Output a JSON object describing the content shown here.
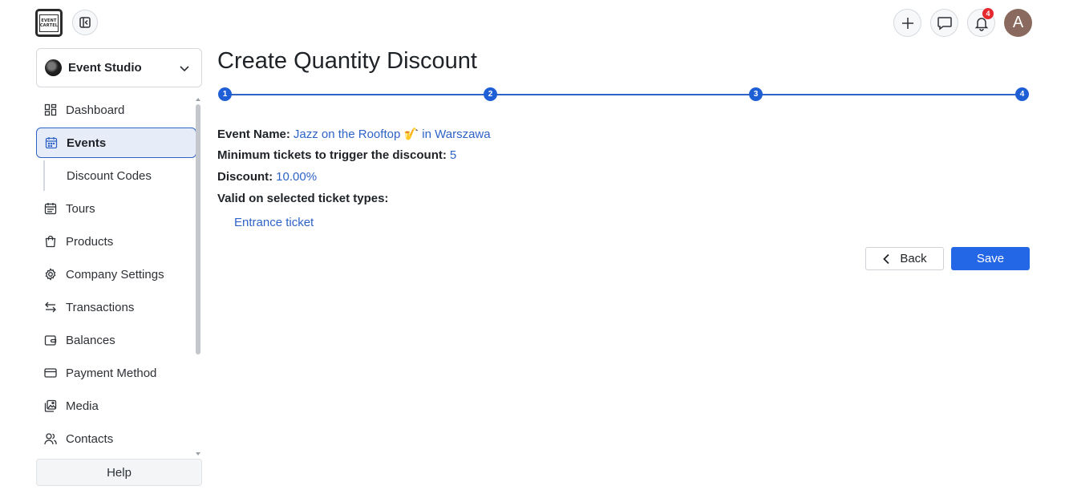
{
  "brand": {
    "logo_line1": "EVENT",
    "logo_line2": "CARTEL"
  },
  "header": {
    "notification_count": "4",
    "avatar_initial": "A"
  },
  "org_selector": {
    "name": "Event Studio"
  },
  "sidebar": {
    "items": [
      {
        "label": "Dashboard",
        "icon": "dashboard-icon"
      },
      {
        "label": "Events",
        "icon": "calendar-icon",
        "active": true
      },
      {
        "label": "Discount Codes",
        "sub": true
      },
      {
        "label": "Tours",
        "icon": "calendar-list-icon"
      },
      {
        "label": "Products",
        "icon": "shopping-bag-icon"
      },
      {
        "label": "Company Settings",
        "icon": "gear-icon"
      },
      {
        "label": "Transactions",
        "icon": "transfer-arrows-icon"
      },
      {
        "label": "Balances",
        "icon": "wallet-icon"
      },
      {
        "label": "Payment Method",
        "icon": "credit-card-icon"
      },
      {
        "label": "Media",
        "icon": "images-icon"
      },
      {
        "label": "Contacts",
        "icon": "users-icon"
      }
    ],
    "help_label": "Help"
  },
  "main": {
    "title": "Create Quantity Discount",
    "steps": [
      "1",
      "2",
      "3",
      "4"
    ],
    "details": {
      "event_name_label": "Event Name:",
      "event_name_value": "Jazz on the Rooftop 🎷 in Warszawa",
      "min_tickets_label": "Minimum tickets to trigger the discount:",
      "min_tickets_value": "5",
      "discount_label": "Discount:",
      "discount_value": "10.00%",
      "ticket_types_label": "Valid on selected ticket types:",
      "ticket_types": [
        "Entrance ticket"
      ]
    },
    "back_label": "Back",
    "save_label": "Save"
  },
  "colors": {
    "accent": "#2467e6",
    "link": "#2f63c7",
    "active_nav_bg": "#e7edf8",
    "badge": "#e5292f",
    "avatar": "#8a6a5e"
  }
}
